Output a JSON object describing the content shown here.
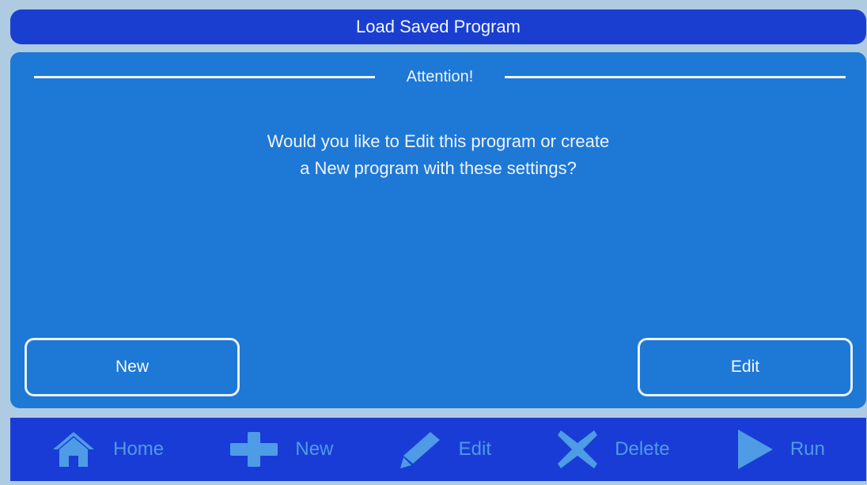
{
  "title_bar": {
    "title": "Load Saved Program"
  },
  "dialog": {
    "heading": "Attention!",
    "message_line1": "Would you like to Edit this program or create",
    "message_line2": "a New program with these settings?",
    "new_button_label": "New",
    "edit_button_label": "Edit"
  },
  "toolbar": {
    "items": [
      {
        "label": "Home",
        "icon": "home-icon"
      },
      {
        "label": "New",
        "icon": "plus-icon"
      },
      {
        "label": "Edit",
        "icon": "pencil-icon"
      },
      {
        "label": "Delete",
        "icon": "x-icon"
      },
      {
        "label": "Run",
        "icon": "play-icon"
      }
    ]
  },
  "colors": {
    "title_bar": "#1a3fd0",
    "dialog_background": "#1e78d6",
    "toolbar_background": "#1a3cd6",
    "toolbar_disabled_text": "#4e9be6",
    "text": "#eef4ff"
  }
}
